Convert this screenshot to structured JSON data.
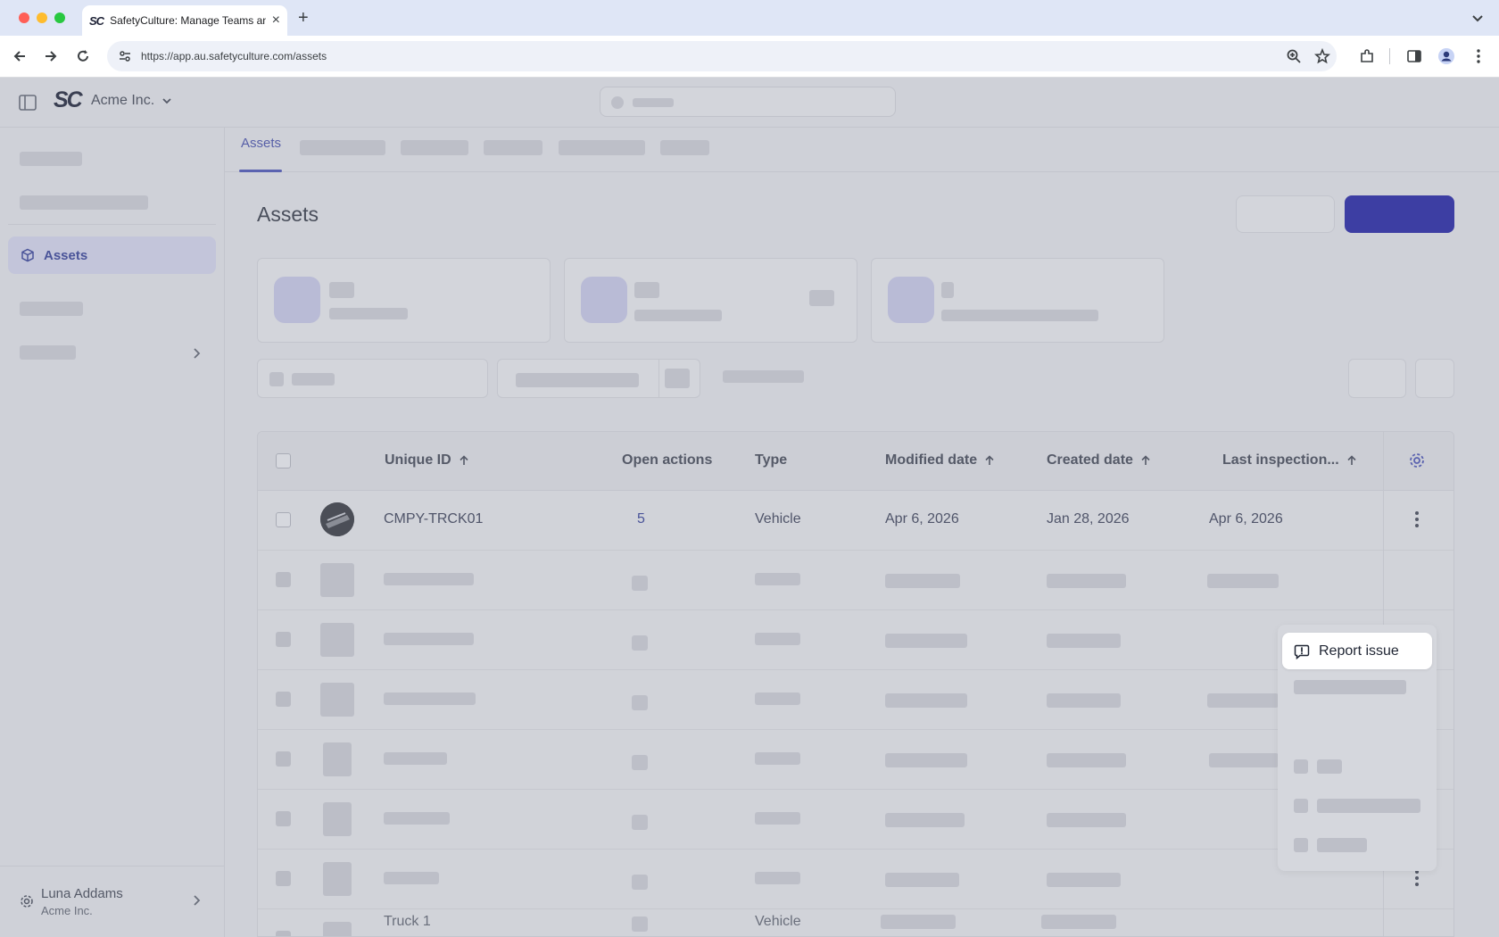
{
  "browser": {
    "tab_title": "SafetyCulture: Manage Teams and...",
    "favicon_text": "SC",
    "url": "https://app.au.safetyculture.com/assets"
  },
  "app": {
    "logo_text": "SC",
    "org_name": "Acme Inc.",
    "sidebar_active_label": "Assets",
    "user_name": "Luna Addams",
    "user_org": "Acme Inc.",
    "subnav_active_tab": "Assets",
    "page_title": "Assets",
    "primary_color": "#3d3ea3"
  },
  "table": {
    "headers": {
      "unique_id": "Unique ID",
      "open_actions": "Open actions",
      "type": "Type",
      "modified_date": "Modified date",
      "created_date": "Created date",
      "last_inspection": "Last inspection..."
    },
    "first_row": {
      "unique_id": "CMPY-TRCK01",
      "open_actions": "5",
      "type": "Vehicle",
      "modified_date": "Apr 6, 2026",
      "created_date": "Jan 28, 2026",
      "last_inspection": "Apr 6, 2026"
    },
    "last_row_partial": {
      "unique_id": "Truck 1",
      "type": "Vehicle"
    }
  },
  "menu": {
    "highlighted_item": "Report issue",
    "highlighted_icon": "report-issue-icon"
  }
}
